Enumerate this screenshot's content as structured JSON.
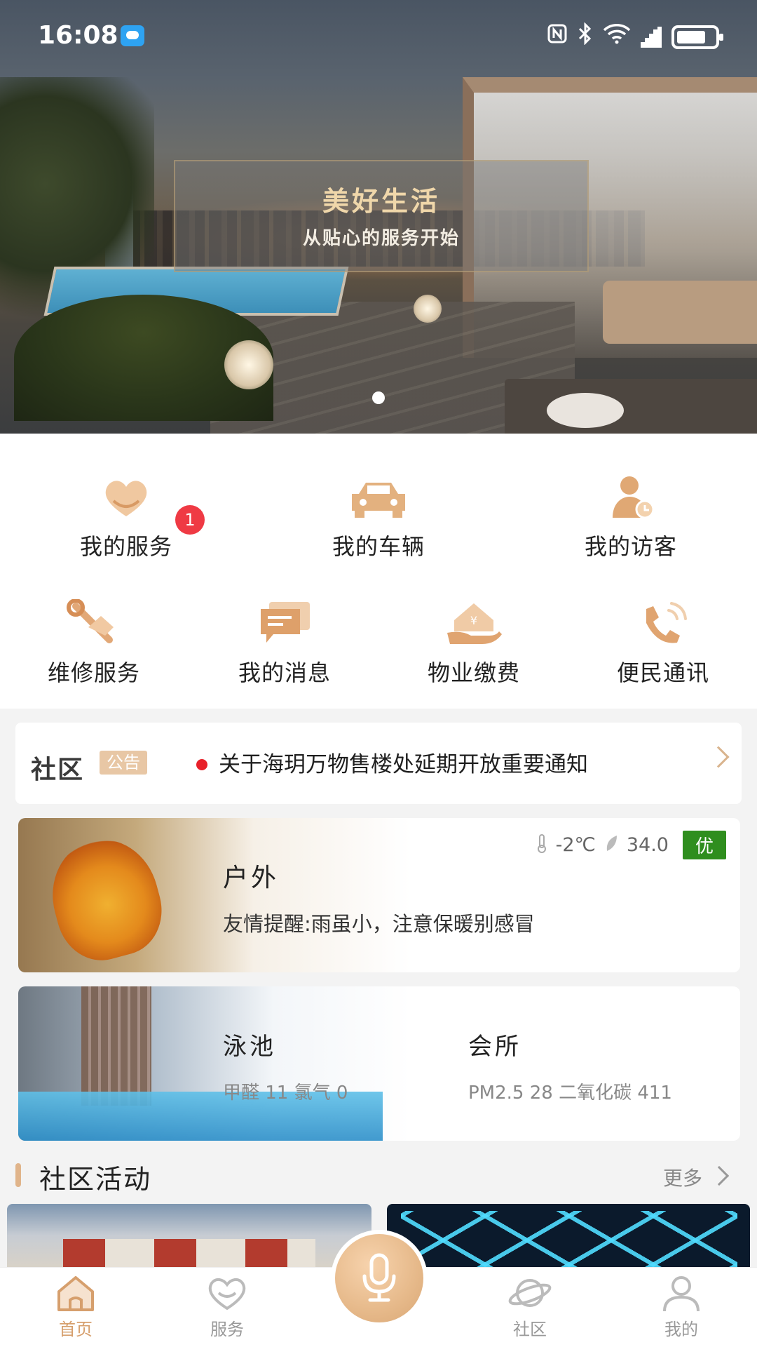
{
  "status_bar": {
    "time": "16:08",
    "icons": [
      "nfc-icon",
      "bluetooth-icon",
      "wifi-icon",
      "signal-icon",
      "battery-icon"
    ]
  },
  "banner": {
    "title": "美好生活",
    "subtitle": "从贴心的服务开始"
  },
  "quick_menu": {
    "row1": [
      {
        "label": "我的服务",
        "icon": "heart-hand-icon",
        "badge": "1"
      },
      {
        "label": "我的车辆",
        "icon": "car-icon"
      },
      {
        "label": "我的访客",
        "icon": "visitor-icon"
      }
    ],
    "row2": [
      {
        "label": "维修服务",
        "icon": "repair-tools-icon"
      },
      {
        "label": "我的消息",
        "icon": "message-icon"
      },
      {
        "label": "物业缴费",
        "icon": "property-fee-icon"
      },
      {
        "label": "便民通讯",
        "icon": "phone-call-icon"
      }
    ]
  },
  "notice": {
    "brand": "社区",
    "tag": "公告",
    "text": "关于海玥万物售楼处延期开放重要通知"
  },
  "weather": {
    "place": "户外",
    "temperature": "-2℃",
    "index": "34.0",
    "quality": "优",
    "tip": "友情提醒:雨虽小，注意保暖别感冒"
  },
  "facilities": [
    {
      "name": "泳池",
      "values": "甲醛 11   氯气 0"
    },
    {
      "name": "会所",
      "values": "PM2.5 28   二氧化碳 411"
    }
  ],
  "activities": {
    "title": "社区活动",
    "more": "更多"
  },
  "tabbar": {
    "home": "首页",
    "service": "服务",
    "community": "社区",
    "mine": "我的"
  },
  "colors": {
    "accent": "#d69f6d",
    "badge": "#ef3a44",
    "aqi_good": "#2f8e1e"
  }
}
